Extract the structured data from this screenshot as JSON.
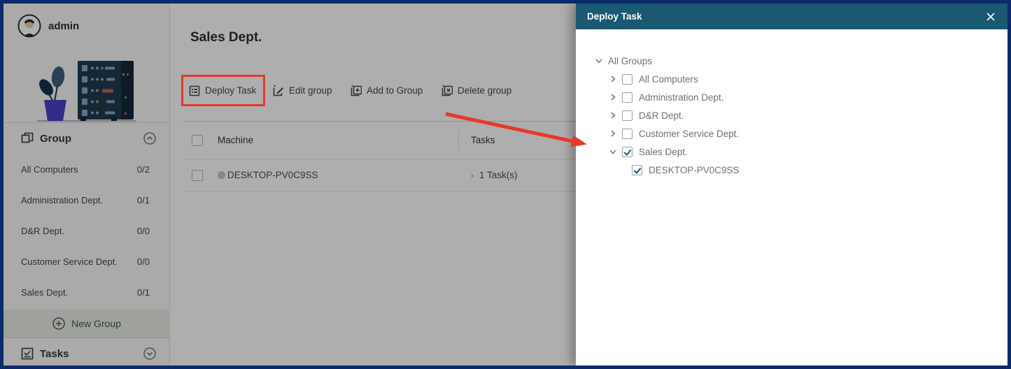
{
  "colors": {
    "accent_red": "#E8382B",
    "dialog_header_teal": "#1A5873",
    "window_border_navy": "#0B2B6B"
  },
  "sidebar": {
    "user": {
      "name": "admin"
    },
    "group_section": {
      "label": "Group",
      "items": [
        {
          "label": "All Computers",
          "count": "0/2"
        },
        {
          "label": "Administration Dept.",
          "count": "0/1"
        },
        {
          "label": "D&R Dept.",
          "count": "0/0"
        },
        {
          "label": "Customer Service Dept.",
          "count": "0/0"
        },
        {
          "label": "Sales Dept.",
          "count": "0/1"
        }
      ],
      "new_group_label": "New Group"
    },
    "tasks_section": {
      "label": "Tasks"
    }
  },
  "main": {
    "title": "Sales Dept.",
    "toolbar": {
      "buttons": [
        {
          "label": "Deploy Task",
          "highlighted": true
        },
        {
          "label": "Edit group",
          "highlighted": false
        },
        {
          "label": "Add to Group",
          "highlighted": false
        },
        {
          "label": "Delete group",
          "highlighted": false
        }
      ]
    },
    "table": {
      "columns": [
        "Machine",
        "Tasks"
      ],
      "rows": [
        {
          "machine": "DESKTOP-PV0C9SS",
          "tasks": "1 Task(s)",
          "expander": "›"
        }
      ]
    }
  },
  "dialog": {
    "title": "Deploy Task",
    "tree": {
      "root": {
        "label": "All Groups",
        "expanded": true
      },
      "nodes": [
        {
          "label": "All Computers",
          "checked": false,
          "expanded": false
        },
        {
          "label": "Administration Dept.",
          "checked": false,
          "expanded": false
        },
        {
          "label": "D&R Dept.",
          "checked": false,
          "expanded": false
        },
        {
          "label": "Customer Service Dept.",
          "checked": false,
          "expanded": false
        },
        {
          "label": "Sales Dept.",
          "checked": true,
          "expanded": true,
          "children": [
            {
              "label": "DESKTOP-PV0C9SS",
              "checked": true
            }
          ]
        }
      ]
    }
  }
}
